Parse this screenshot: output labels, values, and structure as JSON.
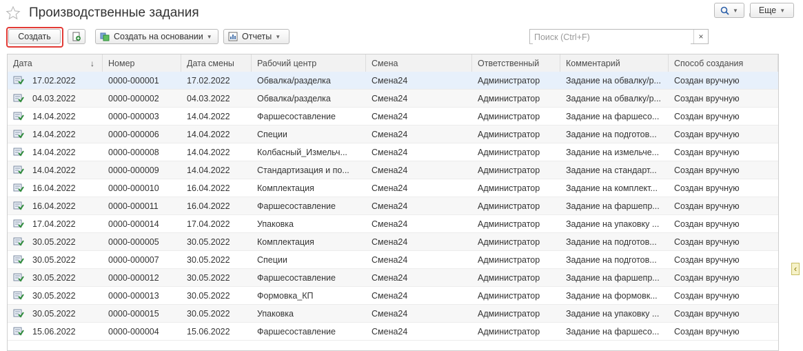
{
  "window": {
    "title": "Производственные задания",
    "icons": [
      "star-icon",
      "link-icon",
      "more-vertical-icon",
      "close-icon"
    ]
  },
  "toolbar": {
    "create_label": "Создать",
    "create_highlight_color": "#e23a35",
    "basis_label": "Создать на основании",
    "reports_label": "Отчеты",
    "more_label": "Еще"
  },
  "search": {
    "placeholder": "Поиск (Ctrl+F)",
    "value": ""
  },
  "table": {
    "columns": [
      "Дата",
      "Номер",
      "Дата смены",
      "Рабочий центр",
      "Смена",
      "Ответственный",
      "Комментарий",
      "Способ создания"
    ],
    "sort_indicator": "↓",
    "rows": [
      [
        "17.02.2022",
        "0000-000001",
        "17.02.2022",
        "Обвалка/разделка",
        "Смена24",
        "Администратор",
        "Задание на обвалку/р...",
        "Создан вручную"
      ],
      [
        "04.03.2022",
        "0000-000002",
        "04.03.2022",
        "Обвалка/разделка",
        "Смена24",
        "Администратор",
        "Задание на обвалку/р...",
        "Создан вручную"
      ],
      [
        "14.04.2022",
        "0000-000003",
        "14.04.2022",
        "Фаршесоставление",
        "Смена24",
        "Администратор",
        "Задание на фаршесо...",
        "Создан вручную"
      ],
      [
        "14.04.2022",
        "0000-000006",
        "14.04.2022",
        "Специи",
        "Смена24",
        "Администратор",
        "Задание на подготов...",
        "Создан вручную"
      ],
      [
        "14.04.2022",
        "0000-000008",
        "14.04.2022",
        "Колбасный_Измельч...",
        "Смена24",
        "Администратор",
        "Задание на измельче...",
        "Создан вручную"
      ],
      [
        "14.04.2022",
        "0000-000009",
        "14.04.2022",
        "Стандартизация и по...",
        "Смена24",
        "Администратор",
        "Задание на стандарт...",
        "Создан вручную"
      ],
      [
        "16.04.2022",
        "0000-000010",
        "16.04.2022",
        "Комплектация",
        "Смена24",
        "Администратор",
        "Задание на комплект...",
        "Создан вручную"
      ],
      [
        "16.04.2022",
        "0000-000011",
        "16.04.2022",
        "Фаршесоставление",
        "Смена24",
        "Администратор",
        "Задание на фаршепр...",
        "Создан вручную"
      ],
      [
        "17.04.2022",
        "0000-000014",
        "17.04.2022",
        "Упаковка",
        "Смена24",
        "Администратор",
        "Задание на упаковку ...",
        "Создан вручную"
      ],
      [
        "30.05.2022",
        "0000-000005",
        "30.05.2022",
        "Комплектация",
        "Смена24",
        "Администратор",
        "Задание на подготов...",
        "Создан вручную"
      ],
      [
        "30.05.2022",
        "0000-000007",
        "30.05.2022",
        "Специи",
        "Смена24",
        "Администратор",
        "Задание на подготов...",
        "Создан вручную"
      ],
      [
        "30.05.2022",
        "0000-000012",
        "30.05.2022",
        "Фаршесоставление",
        "Смена24",
        "Администратор",
        "Задание на фаршепр...",
        "Создан вручную"
      ],
      [
        "30.05.2022",
        "0000-000013",
        "30.05.2022",
        "Формовка_КП",
        "Смена24",
        "Администратор",
        "Задание на формовк...",
        "Создан вручную"
      ],
      [
        "30.05.2022",
        "0000-000015",
        "30.05.2022",
        "Упаковка",
        "Смена24",
        "Администратор",
        "Задание на упаковку ...",
        "Создан вручную"
      ],
      [
        "15.06.2022",
        "0000-000004",
        "15.06.2022",
        "Фаршесоставление",
        "Смена24",
        "Администратор",
        "Задание на фаршесо...",
        "Создан вручную"
      ]
    ],
    "selected_row": 0
  },
  "colors": {
    "selected_row": "#e7f0fb",
    "doc_icon": "#2e8b3a",
    "accent": "#e23a35"
  }
}
